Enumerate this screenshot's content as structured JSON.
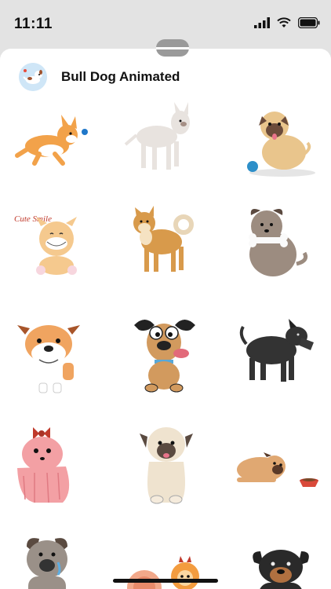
{
  "status_bar": {
    "time": "11:11"
  },
  "header": {
    "title": "Bull Dog Animated",
    "icon": "app-icon-dog"
  },
  "stickers": [
    {
      "name": "corgi-jumping"
    },
    {
      "name": "bull-terrier-standing"
    },
    {
      "name": "pug-with-ball"
    },
    {
      "name": "cute-smile-puppy",
      "caption": "Cute Smile"
    },
    {
      "name": "shiba-inu"
    },
    {
      "name": "dog-with-bone"
    },
    {
      "name": "bulldog-face"
    },
    {
      "name": "cartoon-dog-tongue"
    },
    {
      "name": "black-schnauzer"
    },
    {
      "name": "pink-dog-with-bow"
    },
    {
      "name": "pug-sitting"
    },
    {
      "name": "pug-with-bowl"
    },
    {
      "name": "gray-dog-crying"
    },
    {
      "name": "pomeranian"
    },
    {
      "name": "rottweiler"
    }
  ],
  "colors": {
    "background": "#e3e3e3",
    "sheet": "#ffffff",
    "text": "#111111"
  }
}
